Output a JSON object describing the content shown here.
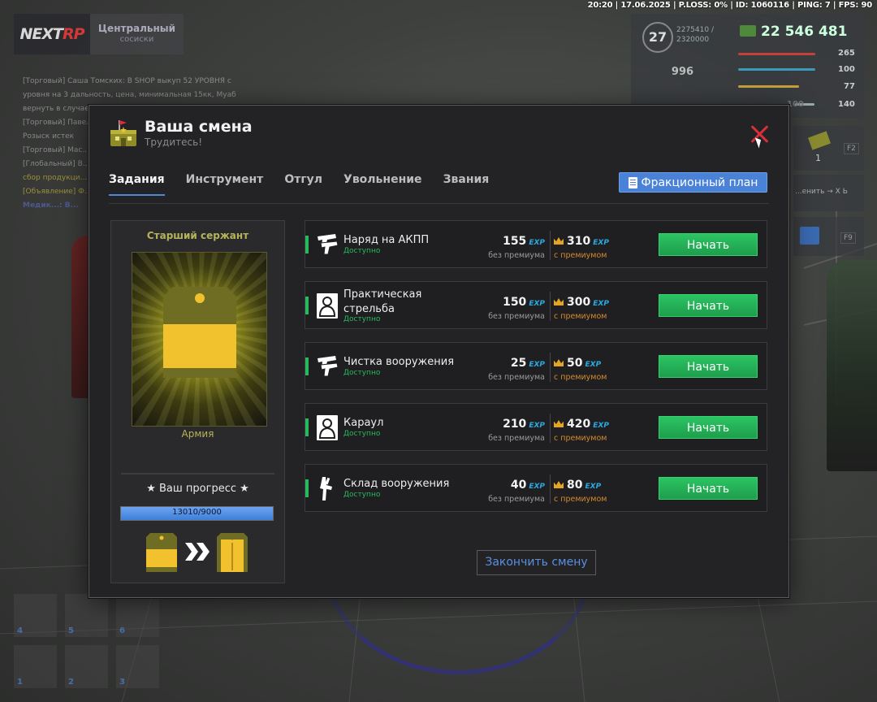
{
  "topbar": {
    "status": "20:20 | 17.06.2025 | P.LOSS: 0% | ID: 1060116 | PING: 7 | FPS: 90"
  },
  "hud": {
    "logo": {
      "main": "NEXT",
      "accent": "RP"
    },
    "server": {
      "name": "Центральный",
      "sub": "сосиски"
    },
    "chat": [
      "[Торговый] Саша Томских: В SHOP выкуп 52 УРОВНЯ с",
      "уровня на 3 дальность, цена, минимальная 15кк, Муаб",
      "вернуть в случае покупки!",
      "[Торговый] Павел...",
      "Розыск истек",
      "[Торговый] Мас...",
      "[Глобальный] В...",
      "сбор продукци...",
      "[Объявление] Ф...",
      "Медик...: В..."
    ],
    "level": "27",
    "exp_current": "2275410 /",
    "exp_total": "2320000",
    "money": "22 546 481",
    "respect": "996",
    "stats": {
      "health": "265",
      "stamina": "100",
      "hunger": "77",
      "armor": "140",
      "armor_left": "100"
    },
    "extra": {
      "f2_count": "1",
      "f2_key": "F2",
      "f9_key": "F9",
      "hint": "...енить → X Ь"
    },
    "slots": [
      "4",
      "5",
      "6",
      "1",
      "2",
      "3"
    ]
  },
  "modal": {
    "title": "Ваша смена",
    "subtitle": "Трудитесь!",
    "tabs": [
      {
        "label": "Задания",
        "active": true
      },
      {
        "label": "Инструмент",
        "active": false
      },
      {
        "label": "Отгул",
        "active": false
      },
      {
        "label": "Увольнение",
        "active": false
      },
      {
        "label": "Звания",
        "active": false
      }
    ],
    "plan_button": "Фракционный план",
    "rank": {
      "title": "Старший сержант",
      "faction": "Армия",
      "progress_label": "★ Ваш прогресс ★",
      "progress_text": "13010/9000",
      "progress_fraction": 1.0
    },
    "exp_unit": "EXP",
    "caption_base": "без премиума",
    "caption_prem": "с премиумом",
    "tasks": [
      {
        "name": "Наряд на АКПП",
        "status": "Доступно",
        "base": "155",
        "premium": "310",
        "button": "Начать",
        "icon": "pistols-icon"
      },
      {
        "name": "Практическая стрельба",
        "status": "Доступно",
        "base": "150",
        "premium": "300",
        "button": "Начать",
        "icon": "target-icon"
      },
      {
        "name": "Чистка вооружения",
        "status": "Доступно",
        "base": "25",
        "premium": "50",
        "button": "Начать",
        "icon": "pistols-icon"
      },
      {
        "name": "Караул",
        "status": "Доступно",
        "base": "210",
        "premium": "420",
        "button": "Начать",
        "icon": "target-icon"
      },
      {
        "name": "Склад вооружения",
        "status": "Доступно",
        "base": "40",
        "premium": "80",
        "button": "Начать",
        "icon": "rifle-icon"
      }
    ],
    "finish_button": "Закончить смену"
  },
  "colors": {
    "accent_green": "#27ba5c",
    "accent_blue": "#4a82d8",
    "exp_blue": "#2aa9e0",
    "premium_orange": "#d48a2a",
    "close_red": "#d8303a",
    "rank_yellow": "#f2c12e"
  }
}
